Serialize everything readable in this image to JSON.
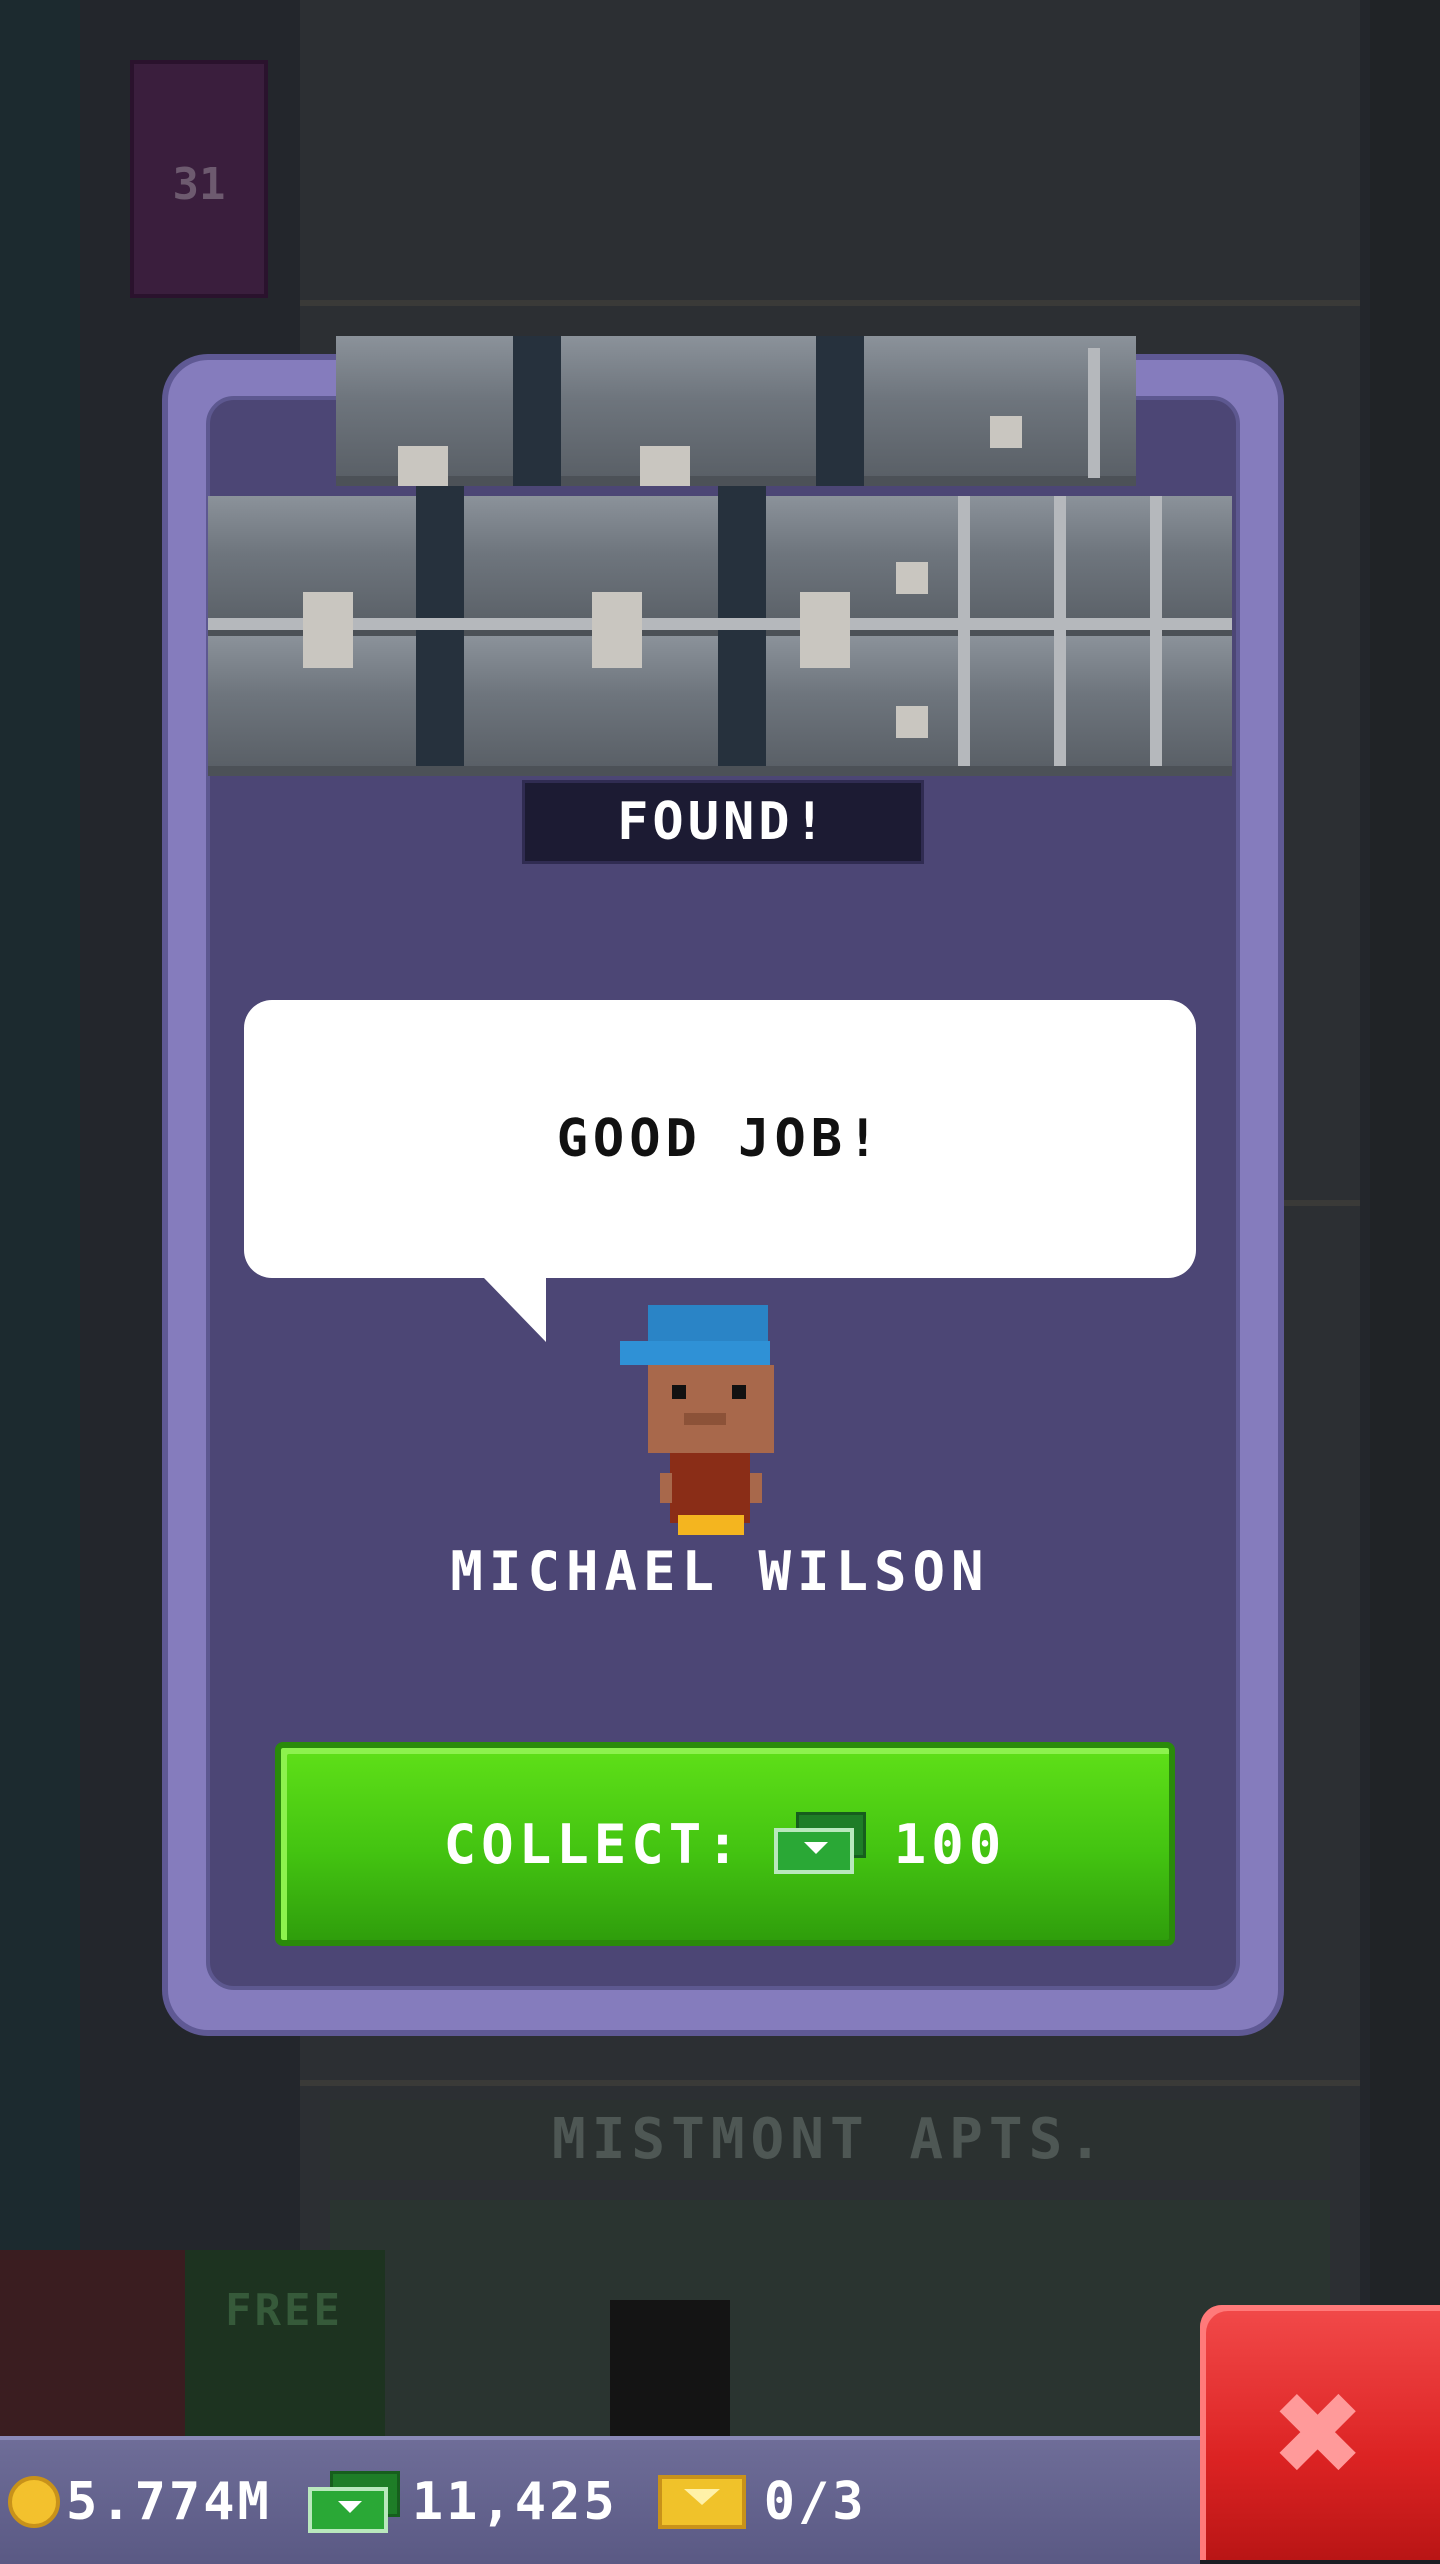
{
  "background": {
    "elevator_floor": "31",
    "building_sign": "MISTMONT APTS.",
    "free_label": "FREE"
  },
  "dialog": {
    "banner": "FOUND!",
    "speech": "GOOD JOB!",
    "character_name": "MICHAEL WILSON",
    "collect_label": "COLLECT:",
    "collect_amount": "100",
    "collect_currency_icon": "tower-bux-icon"
  },
  "status_bar": {
    "coins": "5.774M",
    "bux": "11,425",
    "tickets": "0/3"
  },
  "colors": {
    "dialog_frame": "#857cbd",
    "dialog_body": "#4c4675",
    "collect_button": "#43c311",
    "close_button": "#dc2323",
    "status_bar": "#5a5984"
  }
}
